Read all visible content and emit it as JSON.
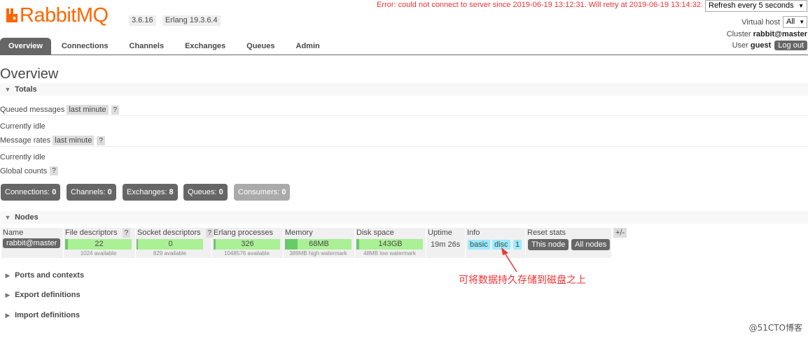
{
  "header": {
    "logo_text": "RabbitMQ",
    "version": "3.6.16",
    "erlang": "Erlang 19.3.6.4",
    "error": "Error: could not connect to server since 2019-06-19 13:12:31. Will retry at 2019-06-19 13:14:32.",
    "refresh_select": "Refresh every 5 seconds",
    "vhost_label": "Virtual host",
    "vhost_value": "All",
    "cluster_label": "Cluster",
    "cluster_value": "rabbit@master",
    "user_label": "User",
    "user_value": "guest",
    "logout": "Log out"
  },
  "tabs": [
    "Overview",
    "Connections",
    "Channels",
    "Exchanges",
    "Queues",
    "Admin"
  ],
  "page_title": "Overview",
  "totals": {
    "title": "Totals",
    "queued_label": "Queued messages",
    "queued_range": "last minute",
    "help": "?",
    "idle1": "Currently idle",
    "rates_label": "Message rates",
    "rates_range": "last minute",
    "idle2": "Currently idle",
    "global_label": "Global counts"
  },
  "counts": [
    {
      "label": "Connections:",
      "value": "0"
    },
    {
      "label": "Channels:",
      "value": "0"
    },
    {
      "label": "Exchanges:",
      "value": "8"
    },
    {
      "label": "Queues:",
      "value": "0"
    },
    {
      "label": "Consumers:",
      "value": "0"
    }
  ],
  "nodes": {
    "title": "Nodes",
    "headers": [
      "Name",
      "File descriptors",
      "Socket descriptors",
      "Erlang processes",
      "Memory",
      "Disk space",
      "Uptime",
      "Info",
      "Reset stats"
    ],
    "name": "rabbit@master",
    "fd": "22",
    "fd_sub": "1024 available",
    "fd_fill": 0.02,
    "sockets": "0",
    "sockets_sub": "829 available",
    "sockets_fill": 0.0,
    "procs": "326",
    "procs_sub": "1048576 available",
    "procs_fill": 0.01,
    "memory": "68MB",
    "memory_sub": "389MB high watermark",
    "memory_fill": 0.17,
    "disk": "143GB",
    "disk_sub": "48MB low watermark",
    "disk_fill": 0.02,
    "uptime": "19m 26s",
    "info_tags": [
      "basic",
      "disc",
      "1"
    ],
    "this_node": "This node",
    "all_nodes": "All nodes",
    "plusminus": "+/-"
  },
  "sections": [
    "Ports and contexts",
    "Export definitions",
    "Import definitions"
  ],
  "annotation": "可将数据持久存储到磁盘之上",
  "watermark": "@51CTO博客",
  "colors": {
    "brand": "#ff6600",
    "error": "#ee3333",
    "bar": "#aaf095",
    "info_tag": "#99ebff",
    "dark": "#666666"
  }
}
